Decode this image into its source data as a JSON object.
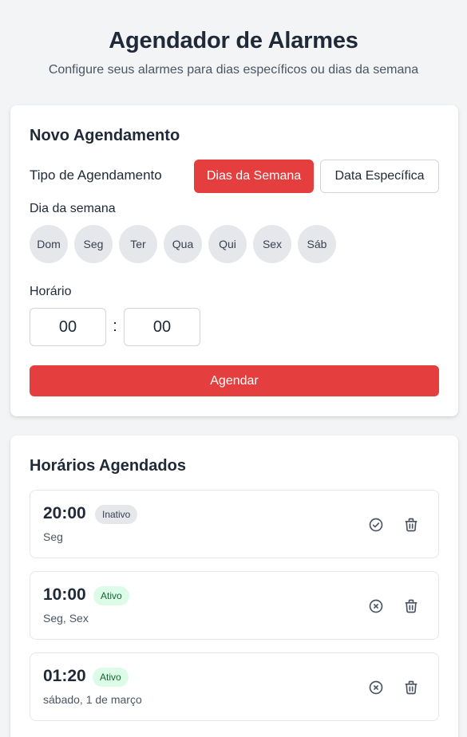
{
  "header": {
    "title": "Agendador de Alarmes",
    "subtitle": "Configure seus alarmes para dias específicos ou dias da semana"
  },
  "form": {
    "title": "Novo Agendamento",
    "type_label": "Tipo de Agendamento",
    "type_options": [
      "Dias da Semana",
      "Data Específica"
    ],
    "selected_type": "Dias da Semana",
    "day_label": "Dia da semana",
    "days": [
      "Dom",
      "Seg",
      "Ter",
      "Qua",
      "Qui",
      "Sex",
      "Sáb"
    ],
    "time_label": "Horário",
    "hour": "00",
    "colon": ":",
    "minute": "00",
    "submit_label": "Agendar"
  },
  "list": {
    "title": "Horários Agendados",
    "alarms": [
      {
        "time": "20:00",
        "status": "Inativo",
        "days": "Seg",
        "toggle_icon": "check-circle-icon"
      },
      {
        "time": "10:00",
        "status": "Ativo",
        "days": "Seg, Sex",
        "toggle_icon": "x-circle-icon"
      },
      {
        "time": "01:20",
        "status": "Ativo",
        "days": "sábado, 1 de março",
        "toggle_icon": "x-circle-icon"
      }
    ]
  },
  "colors": {
    "accent": "#e53e3e",
    "active_badge_bg": "#dcfce7",
    "active_badge_text": "#166534",
    "inactive_badge_bg": "#e5e7eb"
  }
}
